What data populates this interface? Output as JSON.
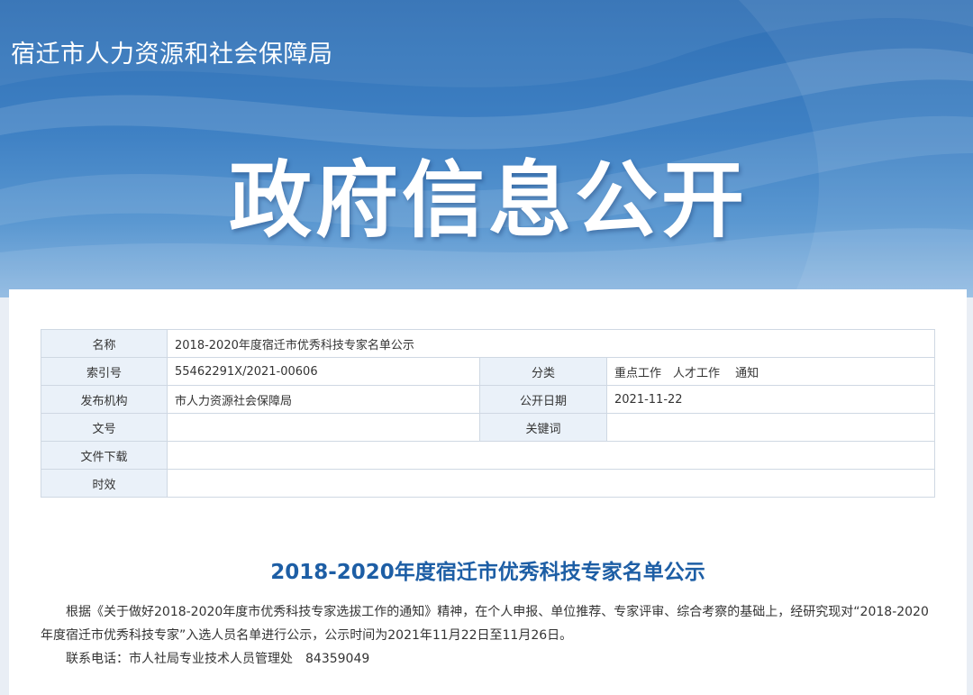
{
  "header": {
    "site_name": "宿迁市人力资源和社会保障局",
    "banner_heading": "政府信息公开"
  },
  "meta_table": {
    "name_label": "名称",
    "name_value": "2018-2020年度宿迁市优秀科技专家名单公示",
    "index_label": "索引号",
    "index_value": "55462291X/2021-00606",
    "category_label": "分类",
    "category_value": "重点工作　人才工作　 通知",
    "publisher_label": "发布机构",
    "publisher_value": "市人力资源社会保障局",
    "date_label": "公开日期",
    "date_value": "2021-11-22",
    "doc_no_label": "文号",
    "doc_no_value": "",
    "keywords_label": "关键词",
    "keywords_value": "",
    "download_label": "文件下载",
    "download_value": "",
    "validity_label": "时效",
    "validity_value": ""
  },
  "article": {
    "title": "2018-2020年度宿迁市优秀科技专家名单公示",
    "paragraph": "根据《关于做好2018-2020年度市优秀科技专家选拔工作的通知》精神，在个人申报、单位推荐、专家评审、综合考察的基础上，经研究现对“2018-2020年度宿迁市优秀科技专家”入选人员名单进行公示，公示时间为2021年11月22日至11月26日。",
    "contact": "联系电话：市人社局专业技术人员管理处　84359049"
  },
  "colors": {
    "banner_top": "#2f6fb4",
    "banner_bottom": "#8ab6e0",
    "label_bg": "#eaf1f9",
    "title_blue": "#1d5ea5",
    "border": "#cfd8e3"
  }
}
